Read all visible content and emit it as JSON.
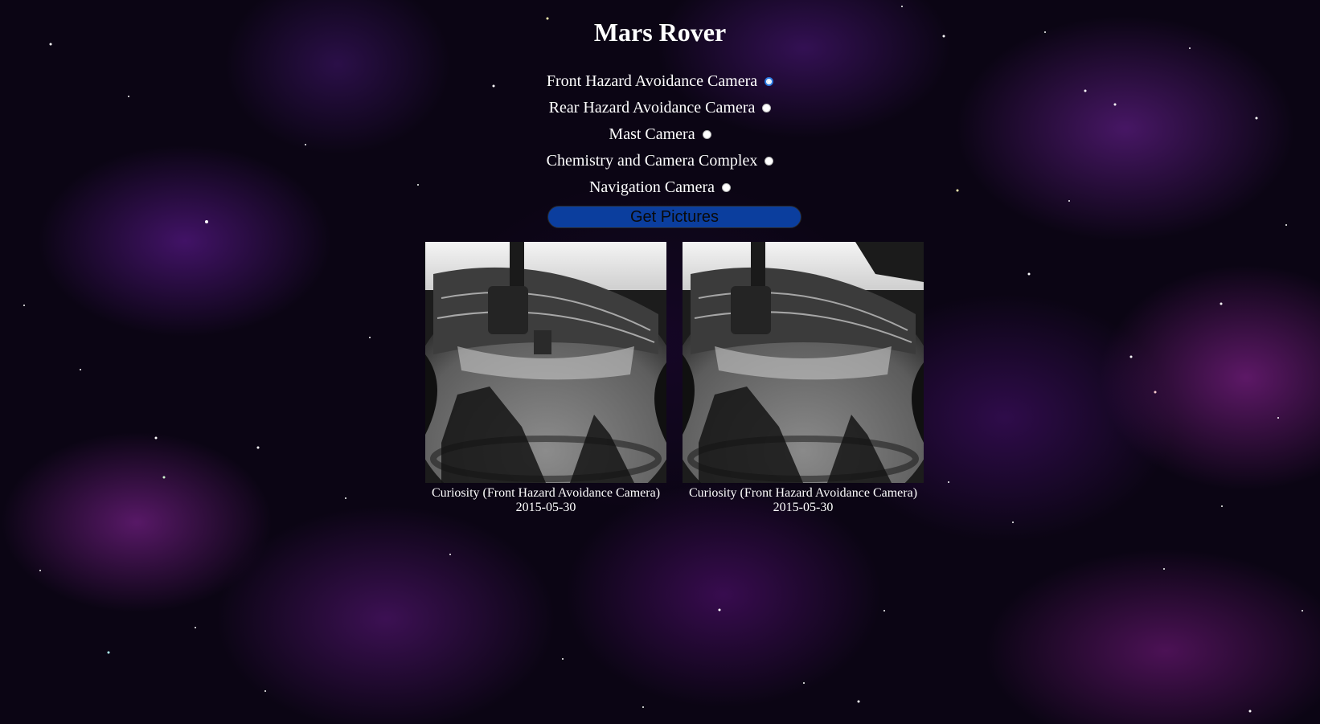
{
  "page": {
    "title": "Mars Rover"
  },
  "cameras": [
    {
      "label": "Front Hazard Avoidance Camera",
      "selected": true
    },
    {
      "label": "Rear Hazard Avoidance Camera",
      "selected": false
    },
    {
      "label": "Mast Camera",
      "selected": false
    },
    {
      "label": "Chemistry and Camera Complex",
      "selected": false
    },
    {
      "label": "Navigation Camera",
      "selected": false
    }
  ],
  "actions": {
    "get_pictures_label": "Get Pictures"
  },
  "photos": [
    {
      "caption": "Curiosity (Front Hazard Avoidance Camera)",
      "date": "2015-05-30"
    },
    {
      "caption": "Curiosity (Front Hazard Avoidance Camera)",
      "date": "2015-05-30"
    }
  ],
  "colors": {
    "button_background": "#0b3e9e",
    "radio_selected": "#2a7ae2",
    "text": "#ffffff"
  }
}
